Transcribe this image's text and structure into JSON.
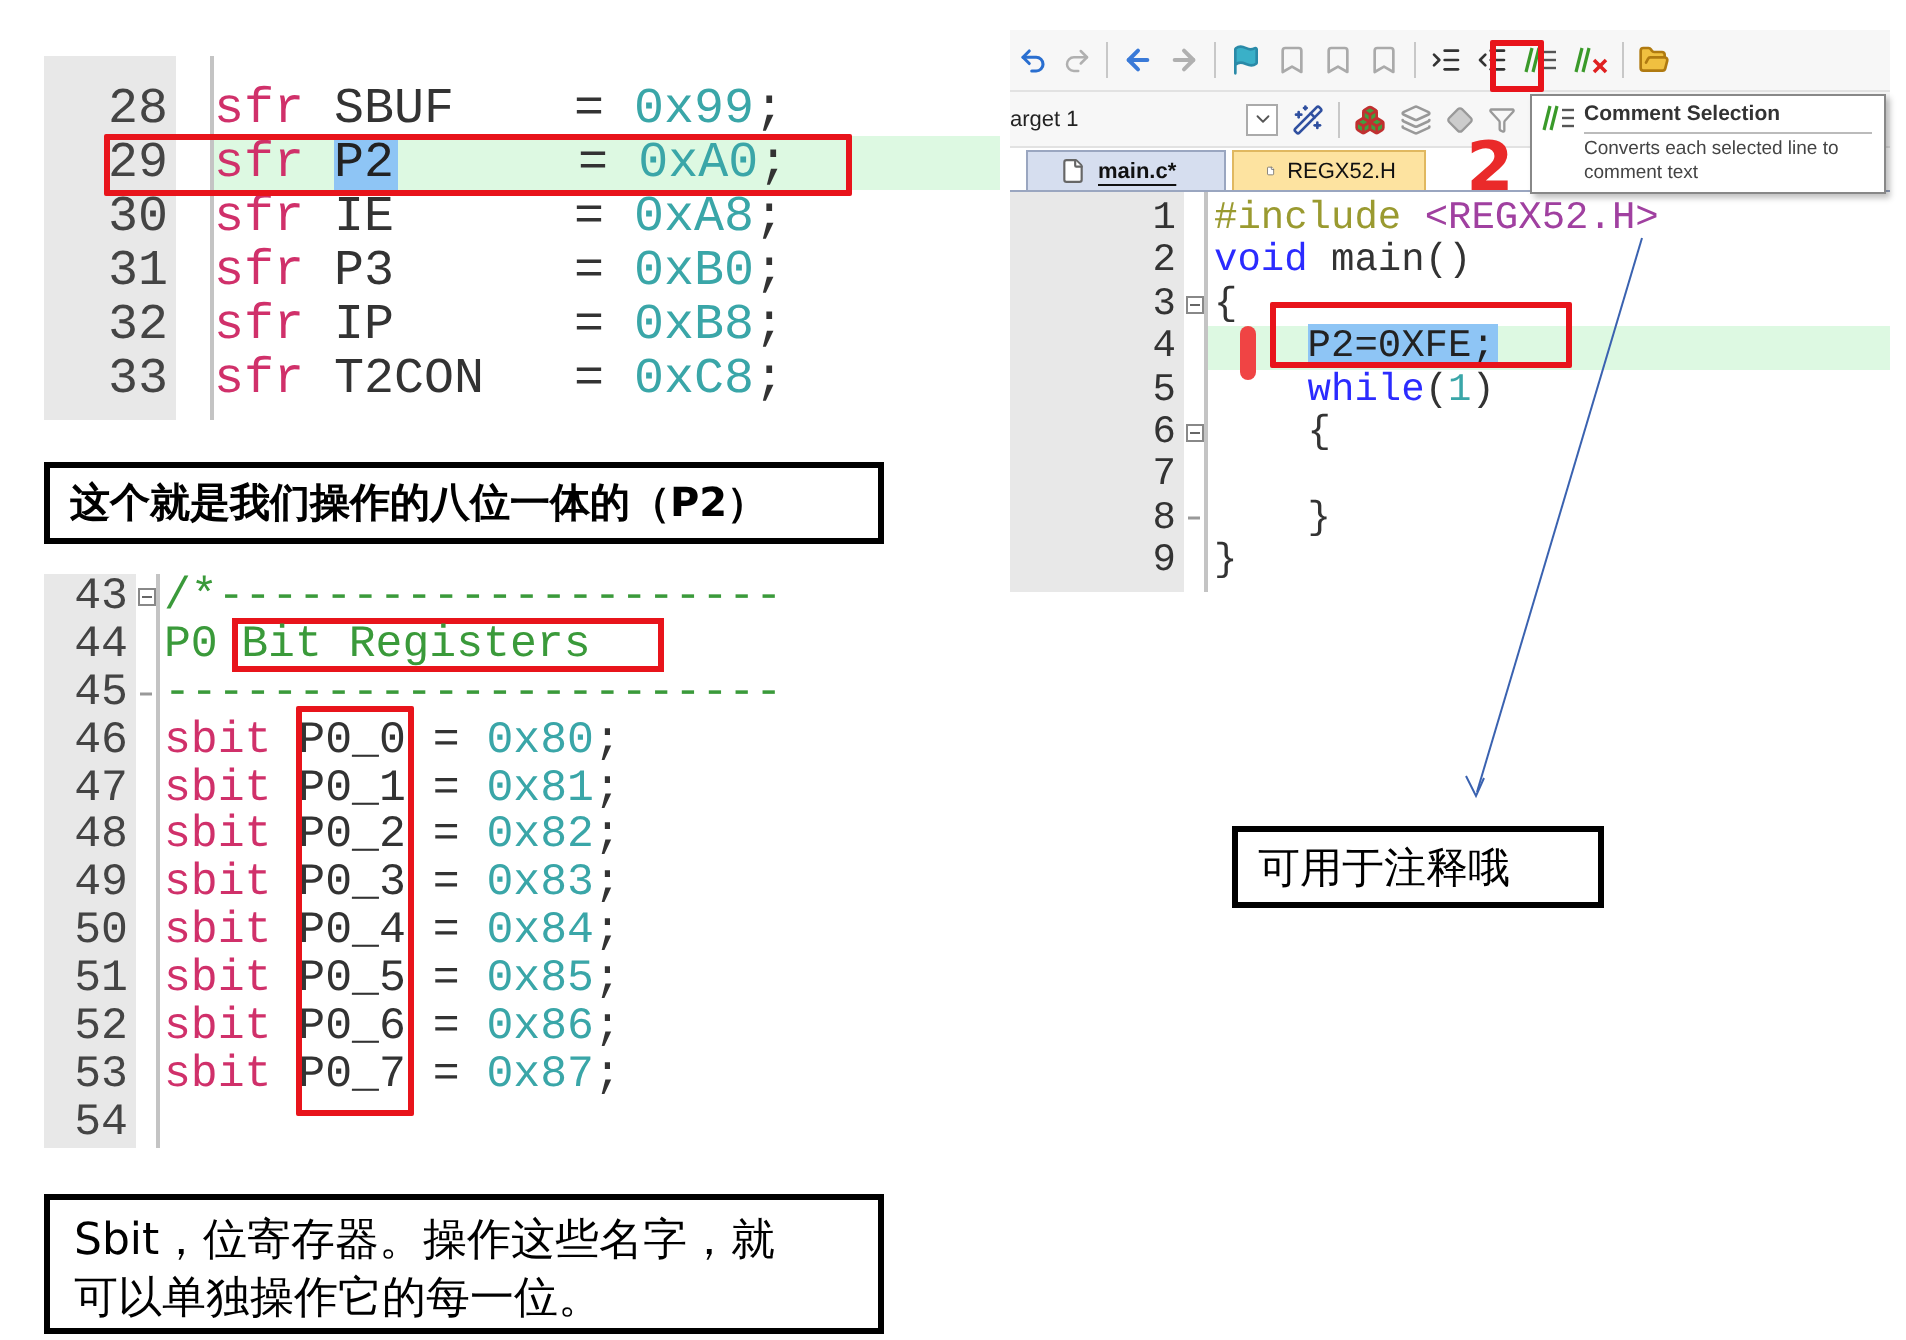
{
  "sfr_listing": {
    "lines": [
      {
        "number": "28",
        "current": false,
        "segments": [
          {
            "text": "sfr ",
            "kind": "keyword"
          },
          {
            "text": "SBUF    = ",
            "kind": "plain"
          },
          {
            "text": "0x99",
            "kind": "number"
          },
          {
            "text": ";",
            "kind": "plain"
          }
        ]
      },
      {
        "number": "29",
        "current": true,
        "segments": [
          {
            "text": "sfr ",
            "kind": "keyword"
          },
          {
            "text": "P2",
            "kind": "selection"
          },
          {
            "text": "      = ",
            "kind": "plain"
          },
          {
            "text": "0xA0",
            "kind": "number"
          },
          {
            "text": ";",
            "kind": "plain"
          }
        ]
      },
      {
        "number": "30",
        "current": false,
        "segments": [
          {
            "text": "sfr ",
            "kind": "keyword"
          },
          {
            "text": "IE      = ",
            "kind": "plain"
          },
          {
            "text": "0xA8",
            "kind": "number"
          },
          {
            "text": ";",
            "kind": "plain"
          }
        ]
      },
      {
        "number": "31",
        "current": false,
        "segments": [
          {
            "text": "sfr ",
            "kind": "keyword"
          },
          {
            "text": "P3      = ",
            "kind": "plain"
          },
          {
            "text": "0xB0",
            "kind": "number"
          },
          {
            "text": ";",
            "kind": "plain"
          }
        ]
      },
      {
        "number": "32",
        "current": false,
        "segments": [
          {
            "text": "sfr ",
            "kind": "keyword"
          },
          {
            "text": "IP      = ",
            "kind": "plain"
          },
          {
            "text": "0xB8",
            "kind": "number"
          },
          {
            "text": ";",
            "kind": "plain"
          }
        ]
      },
      {
        "number": "33",
        "current": false,
        "segments": [
          {
            "text": "sfr ",
            "kind": "keyword"
          },
          {
            "text": "T2CON   = ",
            "kind": "plain"
          },
          {
            "text": "0xC8",
            "kind": "number"
          },
          {
            "text": ";",
            "kind": "plain"
          }
        ]
      }
    ]
  },
  "caption": "这个就是我们操作的八位一体的（P2）",
  "editor": {
    "target": "arget 1",
    "tabs": [
      {
        "label": "main.c*",
        "selected": true
      },
      {
        "label": "REGX52.H",
        "selected": false
      }
    ],
    "tooltip": {
      "title": "Comment Selection",
      "description": "Converts each selected line to comment text"
    },
    "step_label": "2",
    "lines": [
      {
        "number": "1",
        "current": false,
        "indented": false,
        "fold_box": false,
        "fold_end": false,
        "segments": [
          {
            "text": "#include ",
            "kind": "preprocessor"
          },
          {
            "text": "<REGX52.H>",
            "kind": "include_path"
          }
        ]
      },
      {
        "number": "2",
        "current": false,
        "indented": false,
        "fold_box": false,
        "fold_end": false,
        "segments": [
          {
            "text": "void",
            "kind": "keyword"
          },
          {
            "text": " main()",
            "kind": "plain"
          }
        ]
      },
      {
        "number": "3",
        "current": false,
        "indented": false,
        "fold_box": true,
        "fold_end": false,
        "segments": [
          {
            "text": "{",
            "kind": "plain"
          }
        ]
      },
      {
        "number": "4",
        "current": true,
        "indented": true,
        "fold_box": false,
        "fold_end": false,
        "segments": [
          {
            "text": "P2=0XFE;",
            "kind": "selection"
          }
        ]
      },
      {
        "number": "5",
        "current": false,
        "indented": true,
        "fold_box": false,
        "fold_end": false,
        "segments": [
          {
            "text": "while",
            "kind": "keyword"
          },
          {
            "text": "(",
            "kind": "plain"
          },
          {
            "text": "1",
            "kind": "number"
          },
          {
            "text": ")",
            "kind": "plain"
          }
        ]
      },
      {
        "number": "6",
        "current": false,
        "indented": true,
        "fold_box": true,
        "fold_end": false,
        "segments": [
          {
            "text": "{",
            "kind": "plain"
          }
        ]
      },
      {
        "number": "7",
        "current": false,
        "fold_box": false,
        "fold_end": false
      },
      {
        "number": "8",
        "current": false,
        "indented": true,
        "fold_box": false,
        "fold_end": true,
        "segments": [
          {
            "text": "}",
            "kind": "plain"
          }
        ]
      },
      {
        "number": "9",
        "current": false,
        "indented": false,
        "fold_box": false,
        "fold_end": false,
        "segments": [
          {
            "text": "}",
            "kind": "plain"
          }
        ]
      }
    ]
  },
  "comment_note": "可用于注释哦",
  "sbit_listing": {
    "lines": [
      {
        "number": "43",
        "fold_box": true,
        "fold_end": false,
        "segments": [
          {
            "text": "/*---------------------",
            "kind": "comment"
          }
        ]
      },
      {
        "number": "44",
        "fold_box": false,
        "fold_end": false,
        "segments": [
          {
            "text": "P0",
            "kind": "comment"
          },
          {
            "text": "Bit Registers",
            "kind": "framed_comment"
          }
        ]
      },
      {
        "number": "45",
        "fold_box": false,
        "fold_end": true,
        "segments": [
          {
            "text": "-----------------------",
            "kind": "comment"
          }
        ]
      },
      {
        "number": "46",
        "fold_box": false,
        "fold_end": false,
        "segments": [
          {
            "text": "sbit",
            "kind": "keyword"
          },
          {
            "text": " P0_0 = ",
            "kind": "plain"
          },
          {
            "text": "0x80",
            "kind": "number"
          },
          {
            "text": ";",
            "kind": "plain"
          }
        ]
      },
      {
        "number": "47",
        "fold_box": false,
        "fold_end": false,
        "segments": [
          {
            "text": "sbit",
            "kind": "keyword"
          },
          {
            "text": " P0_1 = ",
            "kind": "plain"
          },
          {
            "text": "0x81",
            "kind": "number"
          },
          {
            "text": ";",
            "kind": "plain"
          }
        ]
      },
      {
        "number": "48",
        "fold_box": false,
        "fold_end": false,
        "segments": [
          {
            "text": "sbit",
            "kind": "keyword"
          },
          {
            "text": " P0_2 = ",
            "kind": "plain"
          },
          {
            "text": "0x82",
            "kind": "number"
          },
          {
            "text": ";",
            "kind": "plain"
          }
        ]
      },
      {
        "number": "49",
        "fold_box": false,
        "fold_end": false,
        "segments": [
          {
            "text": "sbit",
            "kind": "keyword"
          },
          {
            "text": " P0_3 = ",
            "kind": "plain"
          },
          {
            "text": "0x83",
            "kind": "number"
          },
          {
            "text": ";",
            "kind": "plain"
          }
        ]
      },
      {
        "number": "50",
        "fold_box": false,
        "fold_end": false,
        "segments": [
          {
            "text": "sbit",
            "kind": "keyword"
          },
          {
            "text": " P0_4 = ",
            "kind": "plain"
          },
          {
            "text": "0x84",
            "kind": "number"
          },
          {
            "text": ";",
            "kind": "plain"
          }
        ]
      },
      {
        "number": "51",
        "fold_box": false,
        "fold_end": false,
        "segments": [
          {
            "text": "sbit",
            "kind": "keyword"
          },
          {
            "text": " P0_5 = ",
            "kind": "plain"
          },
          {
            "text": "0x85",
            "kind": "number"
          },
          {
            "text": ";",
            "kind": "plain"
          }
        ]
      },
      {
        "number": "52",
        "fold_box": false,
        "fold_end": false,
        "segments": [
          {
            "text": "sbit",
            "kind": "keyword"
          },
          {
            "text": " P0_6 = ",
            "kind": "plain"
          },
          {
            "text": "0x86",
            "kind": "number"
          },
          {
            "text": ";",
            "kind": "plain"
          }
        ]
      },
      {
        "number": "53",
        "fold_box": false,
        "fold_end": false,
        "segments": [
          {
            "text": "sbit",
            "kind": "keyword"
          },
          {
            "text": " P0_7 = ",
            "kind": "plain"
          },
          {
            "text": "0x87",
            "kind": "number"
          },
          {
            "text": ";",
            "kind": "plain"
          }
        ]
      },
      {
        "number": "54",
        "fold_box": false,
        "fold_end": false
      }
    ]
  },
  "sbit_note": "Sbit，位寄存器。操作这些名字，就可以单独操作它的每一位。"
}
